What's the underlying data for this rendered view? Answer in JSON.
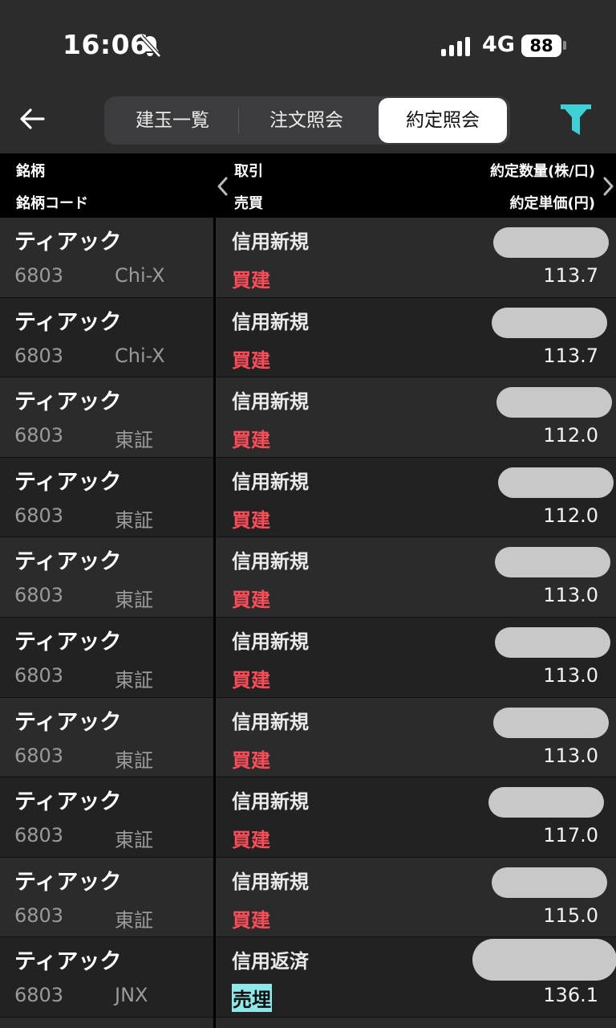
{
  "status_bar": {
    "time": "16:06",
    "network": "4G",
    "battery": "88"
  },
  "header": {
    "tabs": [
      {
        "label": "建玉一覧",
        "selected": false
      },
      {
        "label": "注文照会",
        "selected": false
      },
      {
        "label": "約定照会",
        "selected": true
      }
    ],
    "accent_color": "#3fd0d6"
  },
  "columns": {
    "name": "銘柄",
    "code": "銘柄コード",
    "trade": "取引",
    "side": "売買",
    "quantity": "約定数量(株/口)",
    "price": "約定単価(円)"
  },
  "rows": [
    {
      "name": "ティアック",
      "code": "6803",
      "market": "Chi-X",
      "trade": "信用新規",
      "side": "買建",
      "price": "113.7"
    },
    {
      "name": "ティアック",
      "code": "6803",
      "market": "Chi-X",
      "trade": "信用新規",
      "side": "買建",
      "price": "113.7"
    },
    {
      "name": "ティアック",
      "code": "6803",
      "market": "東証",
      "trade": "信用新規",
      "side": "買建",
      "price": "112.0"
    },
    {
      "name": "ティアック",
      "code": "6803",
      "market": "東証",
      "trade": "信用新規",
      "side": "買建",
      "price": "112.0"
    },
    {
      "name": "ティアック",
      "code": "6803",
      "market": "東証",
      "trade": "信用新規",
      "side": "買建",
      "price": "113.0"
    },
    {
      "name": "ティアック",
      "code": "6803",
      "market": "東証",
      "trade": "信用新規",
      "side": "買建",
      "price": "113.0"
    },
    {
      "name": "ティアック",
      "code": "6803",
      "market": "東証",
      "trade": "信用新規",
      "side": "買建",
      "price": "113.0"
    },
    {
      "name": "ティアック",
      "code": "6803",
      "market": "東証",
      "trade": "信用新規",
      "side": "買建",
      "price": "117.0"
    },
    {
      "name": "ティアック",
      "code": "6803",
      "market": "東証",
      "trade": "信用新規",
      "side": "買建",
      "price": "115.0"
    },
    {
      "name": "ティアック",
      "code": "6803",
      "market": "JNX",
      "trade": "信用返済",
      "side": "売埋",
      "price": "136.1"
    }
  ]
}
